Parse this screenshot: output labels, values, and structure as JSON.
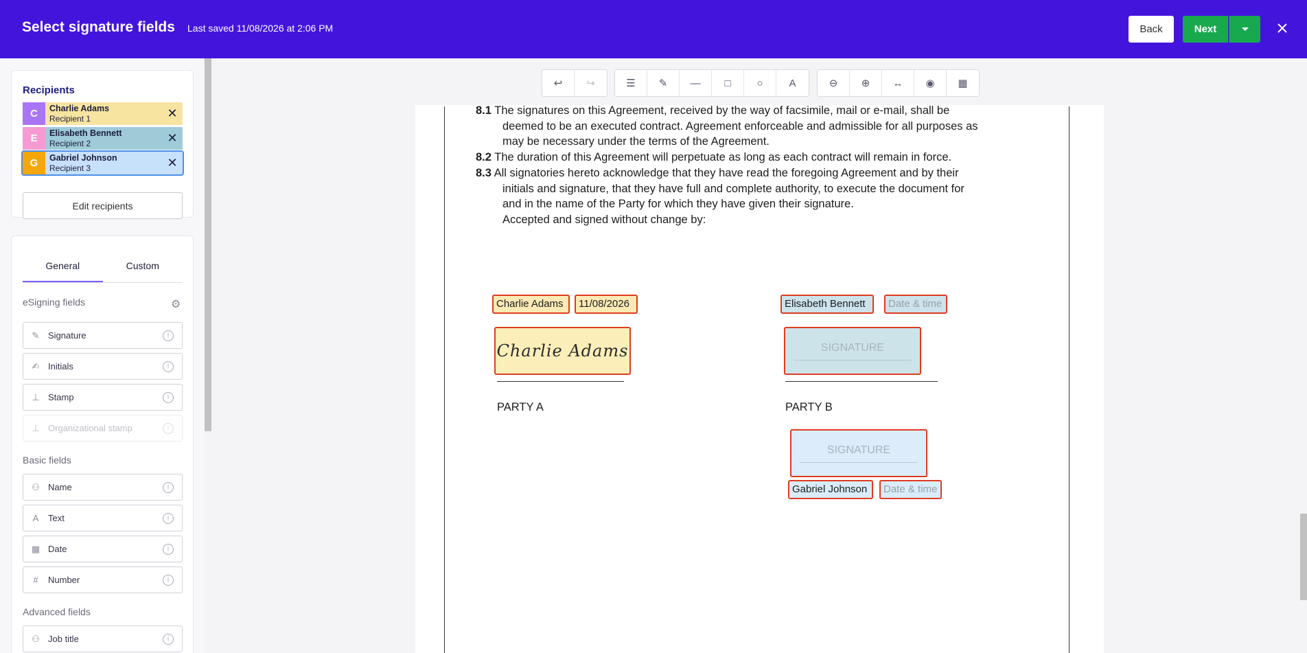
{
  "header": {
    "title": "Select signature fields",
    "saved": "Last saved 11/08/2026 at 2:06 PM",
    "back": "Back",
    "next": "Next",
    "close_icon": "close-icon",
    "dropdown_icon": "caret-down-icon"
  },
  "recipients": {
    "title": "Recipients",
    "items": [
      {
        "initial": "C",
        "name": "Charlie Adams",
        "role": "Recipient 1",
        "color": "#a875f5",
        "bg": "#f7e4a0"
      },
      {
        "initial": "E",
        "name": "Elisabeth Bennett",
        "role": "Recipient 2",
        "color": "#f59ad3",
        "bg": "#9fcbd8"
      },
      {
        "initial": "G",
        "name": "Gabriel Johnson",
        "role": "Recipient 3",
        "color": "#f5a70a",
        "bg": "#c7e1fb"
      }
    ],
    "edit": "Edit recipients"
  },
  "fields_panel": {
    "tabs": [
      "General",
      "Custom"
    ],
    "esigning_label": "eSigning fields",
    "esigning": [
      "Signature",
      "Initials",
      "Stamp",
      "Organizational stamp"
    ],
    "basic_label": "Basic fields",
    "basic": [
      "Name",
      "Text",
      "Date",
      "Number"
    ],
    "advanced_label": "Advanced fields",
    "advanced": [
      "Job title"
    ]
  },
  "document": {
    "clauses": [
      {
        "num": "8.1",
        "lines": [
          "The signatures on this Agreement, received by the way of facsimile, mail or e-mail, shall be",
          "deemed to be an executed contract. Agreement enforceable and admissible for all purposes as",
          "may be necessary under the terms of the Agreement."
        ]
      },
      {
        "num": "8.2",
        "lines": [
          "The duration of this Agreement will perpetuate as long as each contract will remain in force."
        ]
      },
      {
        "num": "8.3",
        "lines": [
          "All signatories hereto acknowledge that they have read the foregoing Agreement and by their",
          "initials and signature, that they have full and complete authority, to execute the document for",
          "and in the name of the Party for which they have given their signature.",
          "Accepted and signed without change by:"
        ]
      }
    ],
    "party_a": "PARTY A",
    "party_b": "PARTY B",
    "a_name": "Charlie Adams",
    "a_date": "11/08/2026",
    "a_sig": "Charlie Adams",
    "b_name": "Elisabeth Bennett",
    "b_date": "Date & time",
    "b_sig": "SIGNATURE",
    "c_sig": "SIGNATURE",
    "c_name": "Gabriel Johnson",
    "c_date": "Date & time"
  }
}
